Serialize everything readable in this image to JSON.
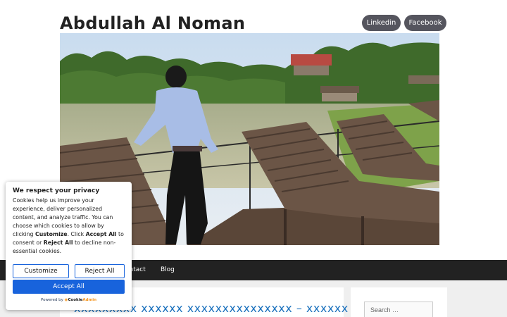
{
  "site": {
    "title": "Abdullah Al Noman",
    "social_links": [
      "Linkedin",
      "Facebook"
    ]
  },
  "hero_image": {
    "description_icon": "hero-photo"
  },
  "nav": {
    "items": [
      "ontact",
      "Blog"
    ]
  },
  "post": {
    "title": "xxxxxxxxx xxxxxx xxxxxxxxxxxxxxx – xxxxxx"
  },
  "sidebar": {
    "search_placeholder": "Search …"
  },
  "cookie_banner": {
    "title": "We respect your privacy",
    "text_1": "Cookies help us improve your experience, deliver personalized content, and analyze traffic. You can choose which cookies to allow by clicking ",
    "text_customize": "Customize",
    "text_2": ". Click ",
    "text_accept": "Accept All",
    "text_3": " to consent or ",
    "text_reject": "Reject All",
    "text_4": " to decline non-essential cookies.",
    "customize_label": "Customize",
    "reject_label": "Reject All",
    "accept_label": "Accept All",
    "powered_by": "Powered by",
    "brand_a": "Cookie",
    "brand_b": "Admin"
  },
  "colors": {
    "nav_bg": "#222222",
    "accent_blue": "#1863dc",
    "social_bg": "#55555e",
    "post_link": "#1e73be"
  }
}
